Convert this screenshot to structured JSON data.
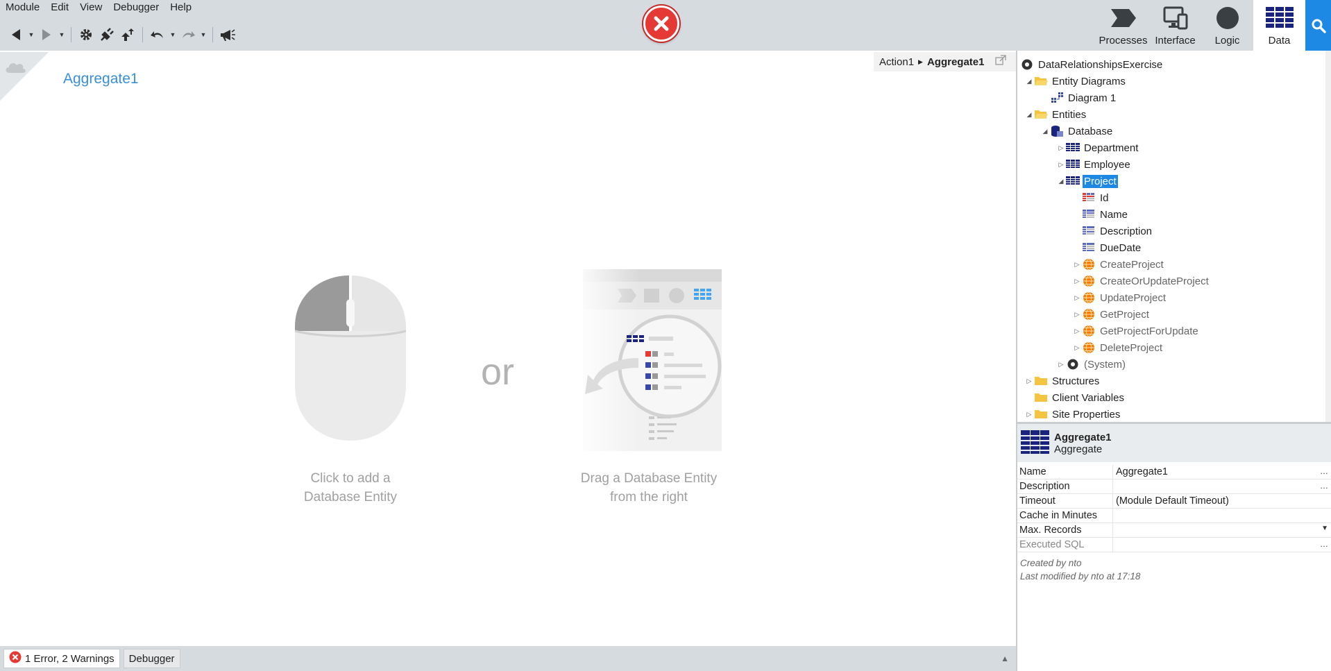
{
  "menu": {
    "items": [
      {
        "label": "Module"
      },
      {
        "label": "Edit"
      },
      {
        "label": "View"
      },
      {
        "label": "Debugger"
      },
      {
        "label": "Help"
      }
    ]
  },
  "toolbar": {
    "buttons": [
      "back-icon",
      "forward-icon",
      "settings-gear-icon",
      "publish-plug-icon",
      "deploy-icon",
      "undo-icon",
      "redo-icon",
      "megaphone-icon"
    ]
  },
  "layer_tabs": [
    {
      "label": "Processes",
      "active": false
    },
    {
      "label": "Interface",
      "active": false
    },
    {
      "label": "Logic",
      "active": false
    },
    {
      "label": "Data",
      "active": true
    }
  ],
  "canvas": {
    "title": "Aggregate1",
    "breadcrumb": {
      "parent": "Action1",
      "current": "Aggregate1"
    },
    "hint_left_line1": "Click to add a",
    "hint_left_line2": "Database Entity",
    "or_label": "or",
    "hint_right_line1": "Drag a Database Entity",
    "hint_right_line2": "from the right"
  },
  "bottom": {
    "errors_tab": "1 Error, 2 Warnings",
    "debugger_tab": "Debugger"
  },
  "tree": {
    "root": "DataRelationshipsExercise",
    "entity_diagrams": "Entity Diagrams",
    "diagram1": "Diagram 1",
    "entities": "Entities",
    "database": "Database",
    "department": "Department",
    "employee": "Employee",
    "project": "Project",
    "attr_id": "Id",
    "attr_name": "Name",
    "attr_description": "Description",
    "attr_duedate": "DueDate",
    "action_create": "CreateProject",
    "action_createorupdate": "CreateOrUpdateProject",
    "action_update": "UpdateProject",
    "action_get": "GetProject",
    "action_getforupdate": "GetProjectForUpdate",
    "action_delete": "DeleteProject",
    "system": "(System)",
    "structures": "Structures",
    "client_variables": "Client Variables",
    "site_properties": "Site Properties"
  },
  "properties": {
    "header_name": "Aggregate1",
    "header_type": "Aggregate",
    "rows": [
      {
        "key": "Name",
        "value": "Aggregate1"
      },
      {
        "key": "Description",
        "value": ""
      },
      {
        "key": "Timeout",
        "value": "(Module Default Timeout)"
      },
      {
        "key": "Cache in Minutes",
        "value": ""
      },
      {
        "key": "Max. Records",
        "value": ""
      },
      {
        "key": "Executed SQL",
        "value": ""
      }
    ],
    "created_by": "Created by nto",
    "modified_by": "Last modified by nto at 17:18"
  },
  "colors": {
    "accent": "#1e88e5",
    "error": "#e53935",
    "title_blue": "#3a8fd6"
  }
}
